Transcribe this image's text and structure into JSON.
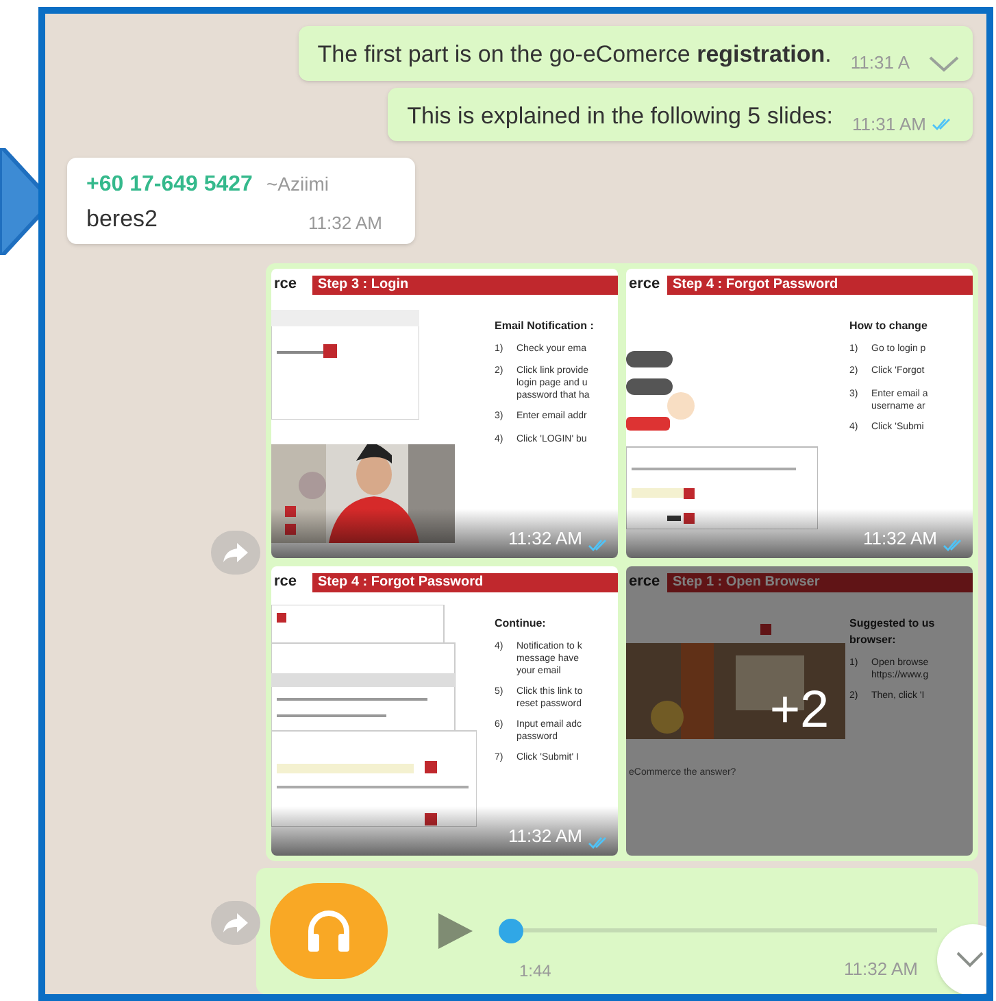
{
  "messages": [
    {
      "kind": "text",
      "outgoing": true,
      "text": "The first part is on the go-eComerce **registration**.",
      "time": "11:31 A",
      "menu": true
    },
    {
      "kind": "text",
      "outgoing": true,
      "text": "This is explained in the following 5 slides:",
      "time": "11:31 AM",
      "read": true
    },
    {
      "kind": "text",
      "outgoing": false,
      "sender": "+60 17-649 5427",
      "push_name": "~Aziimi",
      "text": "beres2",
      "time": "11:32 AM"
    },
    {
      "kind": "album",
      "outgoing": true,
      "tiles": [
        {
          "brand": "rce",
          "title": "Step  3 : Login",
          "heading": "Email Notification :",
          "items": [
            {
              "num": "1)",
              "lines": [
                "Check your ema"
              ]
            },
            {
              "num": "2)",
              "lines": [
                "Click link provide",
                "login page and u",
                "password that ha"
              ]
            },
            {
              "num": "3)",
              "lines": [
                "Enter email addr"
              ]
            },
            {
              "num": "4)",
              "lines": [
                "Click 'LOGIN' bu"
              ]
            }
          ],
          "time": "11:32 AM",
          "read": true
        },
        {
          "brand": "erce",
          "title": "Step  4 : Forgot Password",
          "kind": "login",
          "heading": "How to change",
          "items": [
            {
              "num": "1)",
              "lines": [
                "Go to login p"
              ]
            },
            {
              "num": "2)",
              "lines": [
                "Click 'Forgot"
              ]
            },
            {
              "num": "3)",
              "lines": [
                "Enter email a",
                "username ar"
              ]
            },
            {
              "num": "4)",
              "lines": [
                "Click 'Submi"
              ]
            }
          ],
          "time": "11:32 AM",
          "read": true
        },
        {
          "brand": "rce",
          "title": "Step  4 : Forgot Password",
          "kind": "stack",
          "heading": "Continue:",
          "items": [
            {
              "num": "4)",
              "lines": [
                "Notification to k",
                "message have",
                "your email"
              ]
            },
            {
              "num": "5)",
              "lines": [
                "Click this link to",
                "reset password"
              ]
            },
            {
              "num": "6)",
              "lines": [
                "Input email adc",
                "password"
              ]
            },
            {
              "num": "7)",
              "lines": [
                "Click 'Submit' I"
              ]
            }
          ],
          "time": "11:32 AM",
          "read": true
        },
        {
          "brand": "erce",
          "title": "Step  1 : Open Browser",
          "kind": "browser",
          "heading": "Suggested to us",
          "heading2": "browser:",
          "items": [
            {
              "num": "1)",
              "lines": [
                "Open browse",
                "https://www.g"
              ]
            },
            {
              "num": "2)",
              "lines": [
                "Then, click 'I"
              ]
            }
          ],
          "caption": "eCommerce the answer?",
          "more": "+2"
        }
      ]
    },
    {
      "kind": "audio",
      "outgoing": true,
      "duration": "1:44",
      "time": "11:32 AM",
      "level": 0
    }
  ]
}
